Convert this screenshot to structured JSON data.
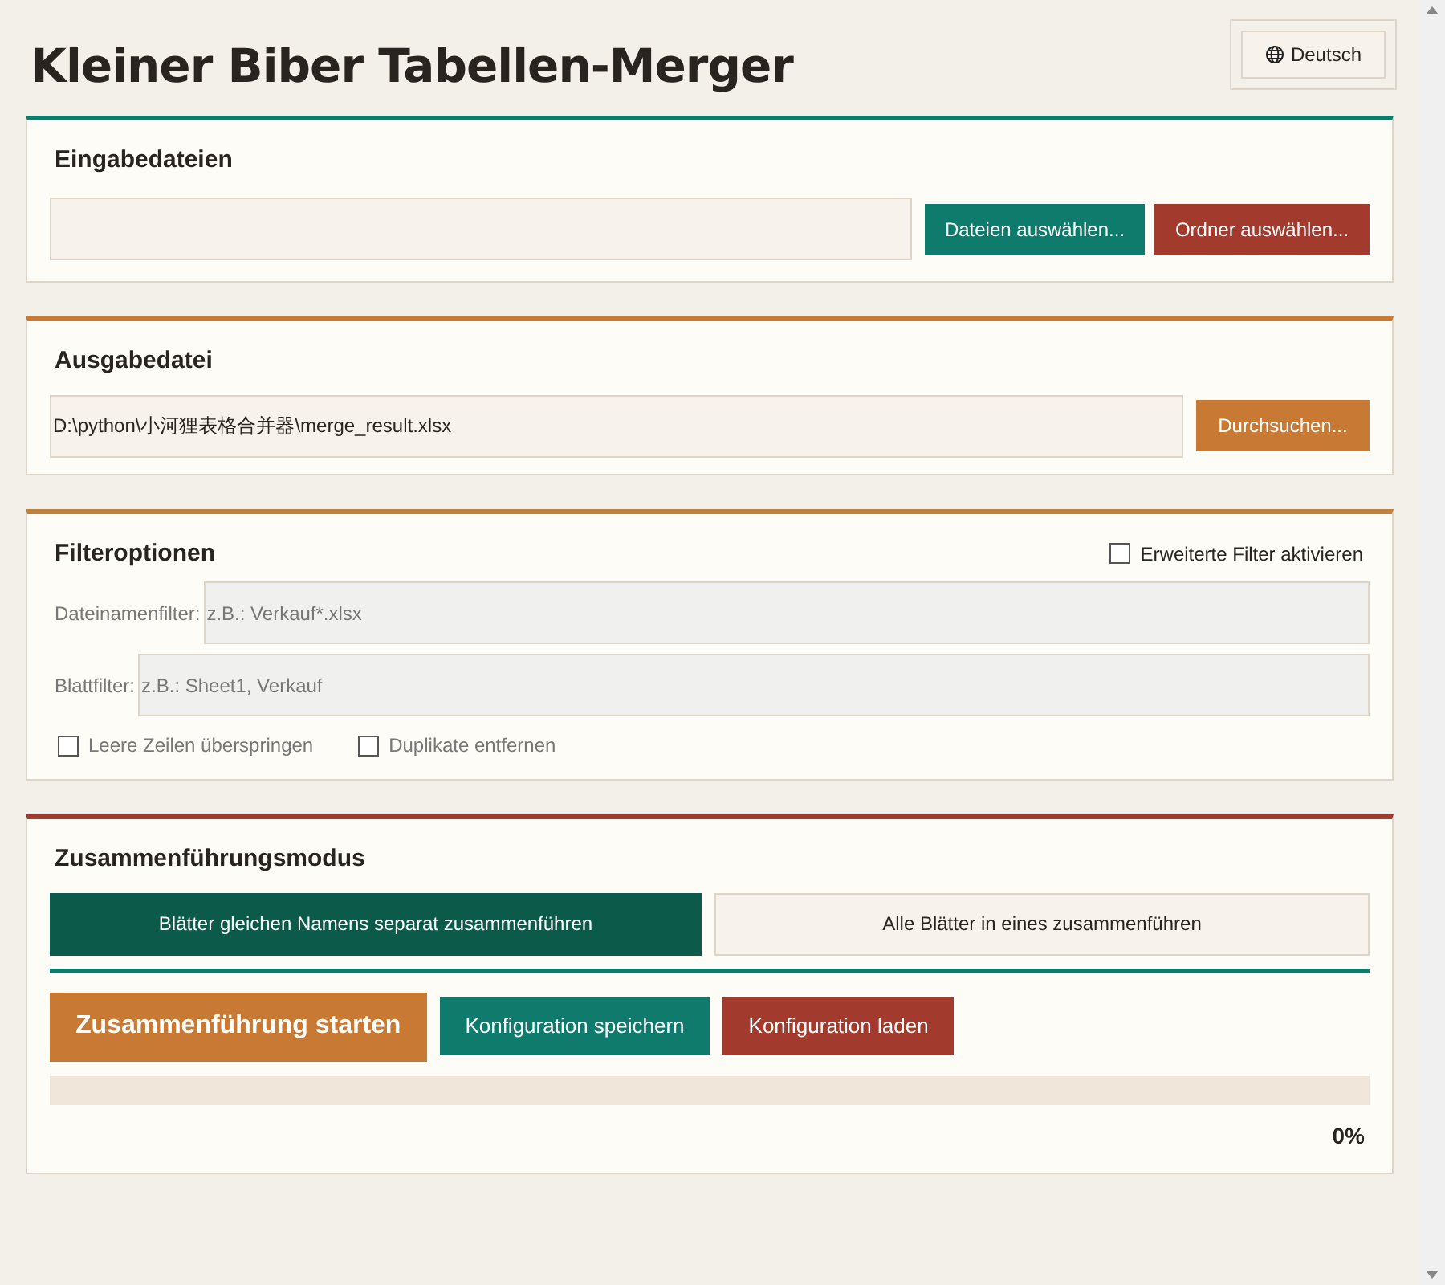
{
  "title": "Kleiner Biber Tabellen-Merger",
  "language_button": "Deutsch",
  "input_section": {
    "title": "Eingabedateien",
    "buttons": [
      "Dateien auswählen...",
      "Ordner auswählen..."
    ]
  },
  "output_section": {
    "title": "Ausgabedatei",
    "path": "D:\\python\\小河狸表格合并器\\merge_result.xlsx",
    "button": "Durchsuchen..."
  },
  "filter_section": {
    "title": "Filteroptionen",
    "advanced": {
      "label": "Erweiterte Filter aktivieren",
      "checked": false
    },
    "fields": [
      {
        "label": "Dateinamenfilter:",
        "placeholder": "z.B.: Verkauf*.xlsx"
      },
      {
        "label": "Blattfilter:",
        "placeholder": "z.B.: Sheet1, Verkauf"
      }
    ],
    "options": [
      {
        "label": "Leere Zeilen überspringen",
        "checked": false
      },
      {
        "label": "Duplikate entfernen",
        "checked": false
      }
    ]
  },
  "mode_section": {
    "title": "Zusammenführungsmodus",
    "modes": [
      {
        "label": "Blätter gleichen Namens separat zusammenführen",
        "selected": true
      },
      {
        "label": "Alle Blätter in eines zusammenführen",
        "selected": false
      }
    ],
    "actions": [
      {
        "label": "Zusammenführung starten",
        "kind": "primary"
      },
      {
        "label": "Konfiguration speichern",
        "kind": "save"
      },
      {
        "label": "Konfiguration laden",
        "kind": "load"
      }
    ],
    "progress": {
      "level": 0,
      "reading": "0%"
    }
  }
}
